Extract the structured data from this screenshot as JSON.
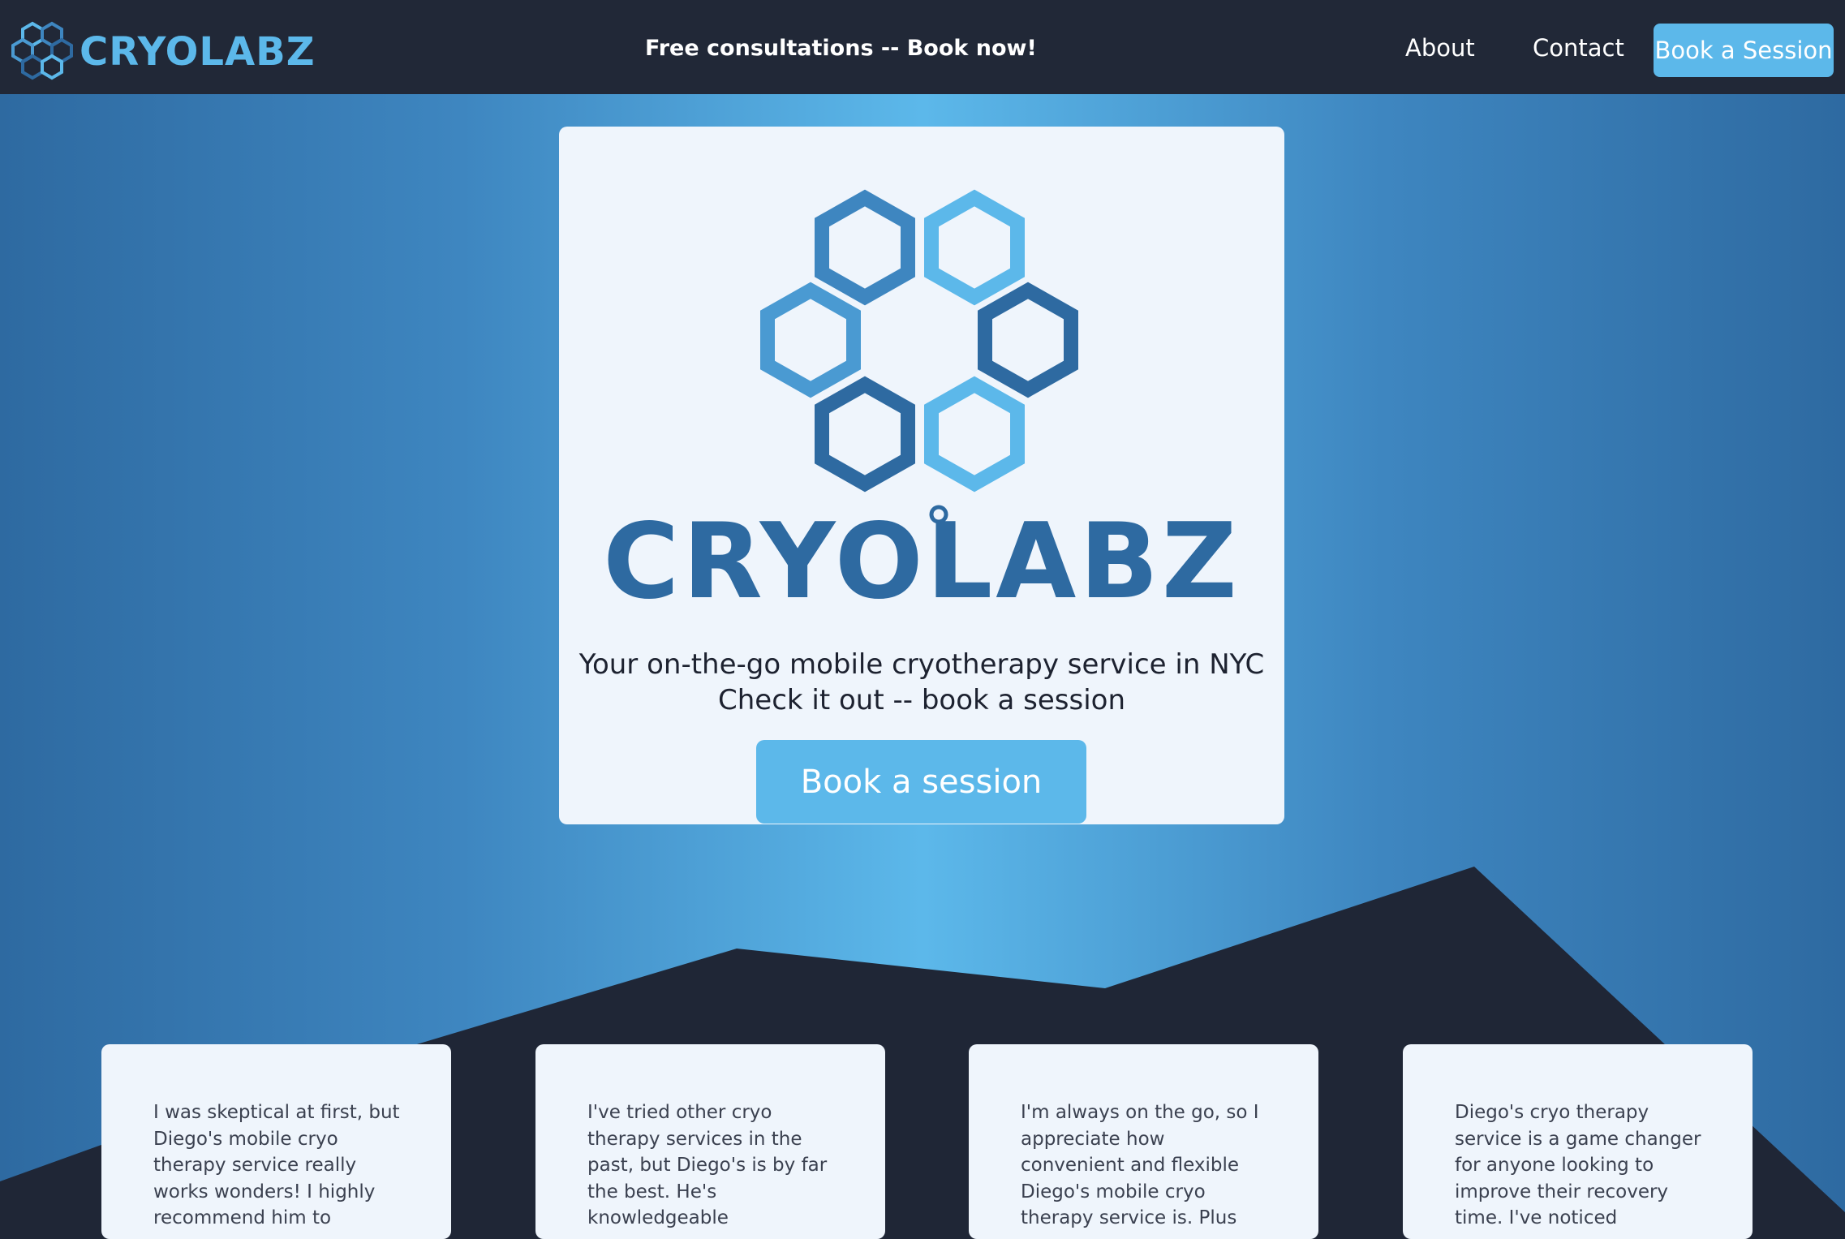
{
  "nav": {
    "brand_alt": "CRYOLABZ logo",
    "brand_text": "CRYOLABZ",
    "promo": "Free consultations -- Book now!",
    "links": [
      {
        "label": "About"
      },
      {
        "label": "Contact"
      }
    ],
    "book_button": "Book a Session"
  },
  "hero": {
    "logo_text": "CRYOLABZ",
    "tagline_1": "Your on-the-go mobile cryotherapy service in NYC",
    "tagline_2": "Check it out -- book a session",
    "cta": "Book a session"
  },
  "testimonials": [
    {
      "text": "I was skeptical at first, but Diego's mobile cryo therapy service really works wonders! I highly recommend him to"
    },
    {
      "text": "I've tried other cryo therapy services in the past, but Diego's is by far the best. He's knowledgeable"
    },
    {
      "text": "I'm always on the go, so I appreciate how convenient and flexible Diego's mobile cryo therapy service is. Plus"
    },
    {
      "text": "Diego's cryo therapy service is a game changer for anyone looking to improve their recovery time. I've noticed"
    }
  ],
  "colors": {
    "nav_bg": "#212837",
    "accent": "#5cb8ea",
    "brand_dark": "#2e6aa1",
    "card_bg": "#eff5fc"
  }
}
